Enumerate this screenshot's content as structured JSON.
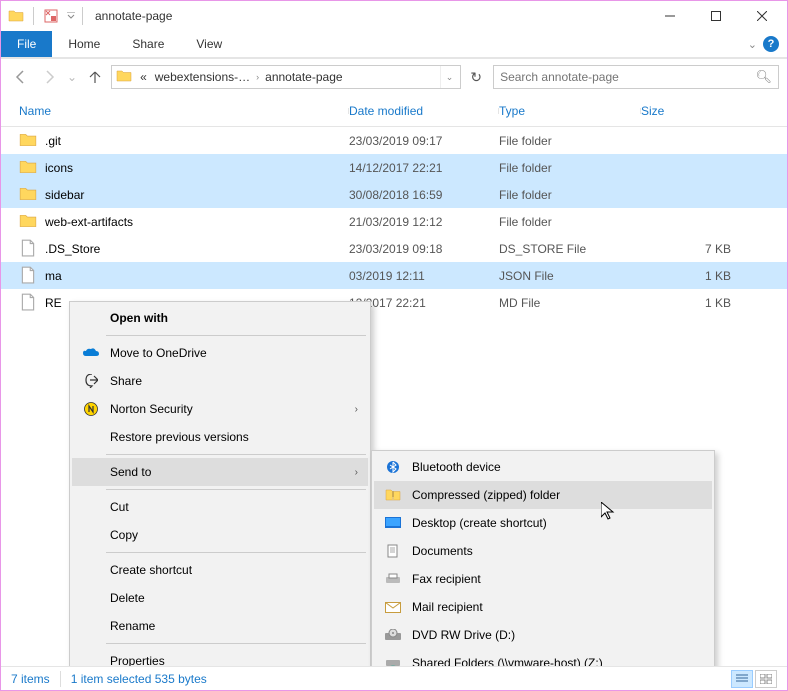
{
  "window": {
    "title": "annotate-page"
  },
  "ribbon": {
    "file": "File",
    "tabs": [
      "Home",
      "Share",
      "View"
    ]
  },
  "breadcrumb": {
    "prefix": "«",
    "segments": [
      "webextensions-…",
      "annotate-page"
    ]
  },
  "search": {
    "placeholder": "Search annotate-page"
  },
  "columns": {
    "name": "Name",
    "date": "Date modified",
    "type": "Type",
    "size": "Size"
  },
  "files": [
    {
      "name": ".git",
      "date": "23/03/2019 09:17",
      "type": "File folder",
      "size": "",
      "kind": "folder",
      "selected": false
    },
    {
      "name": "icons",
      "date": "14/12/2017 22:21",
      "type": "File folder",
      "size": "",
      "kind": "folder",
      "selected": true
    },
    {
      "name": "sidebar",
      "date": "30/08/2018 16:59",
      "type": "File folder",
      "size": "",
      "kind": "folder",
      "selected": true
    },
    {
      "name": "web-ext-artifacts",
      "date": "21/03/2019 12:12",
      "type": "File folder",
      "size": "",
      "kind": "folder",
      "selected": false
    },
    {
      "name": ".DS_Store",
      "date": "23/03/2019 09:18",
      "type": "DS_STORE File",
      "size": "7 KB",
      "kind": "file",
      "selected": false
    },
    {
      "name": "ma",
      "date": "03/2019 12:11",
      "type": "JSON File",
      "size": "1 KB",
      "kind": "file",
      "selected": true
    },
    {
      "name": "RE",
      "date": "12/2017 22:21",
      "type": "MD File",
      "size": "1 KB",
      "kind": "file",
      "selected": false
    }
  ],
  "context_menu": {
    "open_with": "Open with",
    "move_onedrive": "Move to OneDrive",
    "share": "Share",
    "norton": "Norton Security",
    "restore": "Restore previous versions",
    "send_to": "Send to",
    "cut": "Cut",
    "copy": "Copy",
    "create_shortcut": "Create shortcut",
    "delete": "Delete",
    "rename": "Rename",
    "properties": "Properties"
  },
  "send_to_menu": {
    "bluetooth": "Bluetooth device",
    "compressed": "Compressed (zipped) folder",
    "desktop": "Desktop (create shortcut)",
    "documents": "Documents",
    "fax": "Fax recipient",
    "mail": "Mail recipient",
    "dvd": "DVD RW Drive (D:)",
    "shared": "Shared Folders (\\\\vmware-host) (Z:)"
  },
  "status": {
    "items": "7 items",
    "selected": "1 item selected  535 bytes"
  }
}
